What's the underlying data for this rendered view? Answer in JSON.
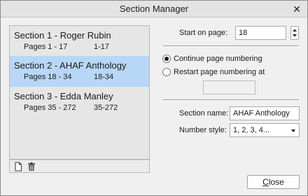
{
  "window": {
    "title": "Section Manager",
    "close_glyph": "✕"
  },
  "sections": [
    {
      "title": "Section 1 - Roger Rubin",
      "range": "Pages 1 - 17",
      "display": "1-17",
      "selected": false
    },
    {
      "title": "Section 2 - AHAF Anthology",
      "range": "Pages 18 - 34",
      "display": "18-34",
      "selected": true
    },
    {
      "title": "Section 3 - Edda Manley",
      "range": "Pages 35 - 272",
      "display": "35-272",
      "selected": false
    }
  ],
  "list_toolbar": {
    "icons": [
      "new-page-icon",
      "trash-icon"
    ]
  },
  "start_page": {
    "label": "Start on page:",
    "value": "18"
  },
  "numbering": {
    "continue_label": "Continue page numbering",
    "restart_label": "Restart page numbering at",
    "selected": "continue",
    "restart_value": ""
  },
  "section_name": {
    "label": "Section name:",
    "value": "AHAF Anthology"
  },
  "number_style": {
    "label": "Number style:",
    "value": "1, 2, 3, 4..."
  },
  "buttons": {
    "close_first": "C",
    "close_rest": "lose"
  },
  "colors": {
    "selection": "#b8d7f7",
    "list_background": "#e6e6e6",
    "dialog_background": "#f0f0f0"
  }
}
